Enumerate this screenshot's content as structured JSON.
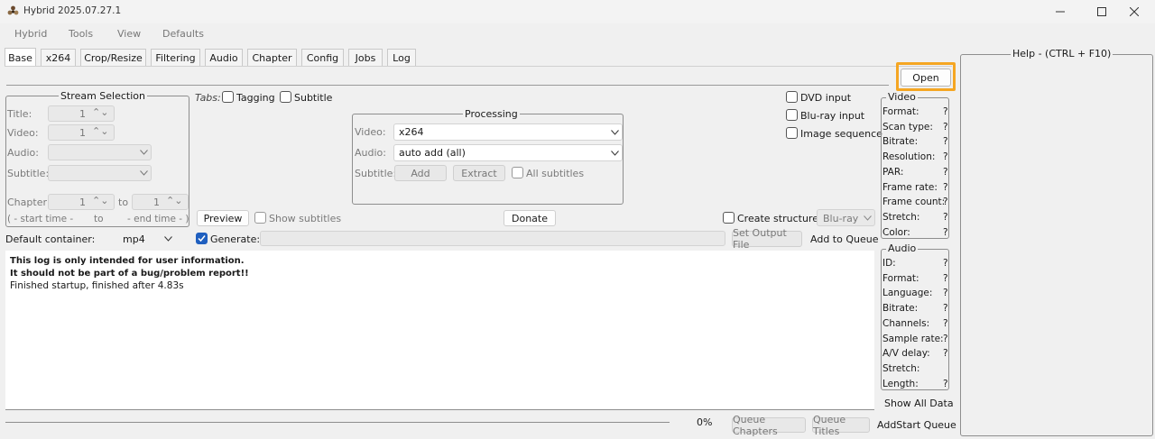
{
  "window": {
    "title": "Hybrid 2025.07.27.1"
  },
  "menu": [
    "Hybrid",
    "Tools",
    "View",
    "Defaults"
  ],
  "tabs": [
    "Base",
    "x264",
    "Crop/Resize",
    "Filtering",
    "Audio",
    "Chapter",
    "Config",
    "Jobs",
    "Log"
  ],
  "open_button": "Open",
  "help_panel": {
    "title": "Help - (CTRL + F10)"
  },
  "stream_selection": {
    "title": "Stream Selection",
    "title_label": "Title:",
    "title_value": "1",
    "video_label": "Video:",
    "video_value": "1",
    "audio_label": "Audio:",
    "subtitle_label": "Subtitle:",
    "chapter_label": "Chapter:",
    "chapter_from": "1",
    "to_label": "to",
    "chapter_to": "1",
    "start_time": "( - start time -",
    "to_label2": "to",
    "end_time": "- end time - )"
  },
  "tabs_options": {
    "label": "Tabs:",
    "tagging": "Tagging",
    "subtitle": "Subtitle"
  },
  "processing": {
    "title": "Processing",
    "video_label": "Video:",
    "video_value": "x264",
    "audio_label": "Audio:",
    "audio_value": "auto add (all)",
    "subtitle_label": "Subtitle:",
    "add": "Add",
    "extract": "Extract",
    "all_subtitles": "All subtitles"
  },
  "inputs": {
    "dvd": "DVD input",
    "bluray": "Blu-ray input",
    "image_seq": "Image sequence"
  },
  "preview": {
    "button": "Preview",
    "show_subtitles": "Show subtitles"
  },
  "donate": "Donate",
  "create_structure": {
    "label": "Create structure:",
    "value": "Blu-ray"
  },
  "output": {
    "default_container_label": "Default container:",
    "container_value": "mp4",
    "generate": "Generate:",
    "set_output": "Set Output File",
    "add_queue": "Add to Queue"
  },
  "log": [
    "This log is only intended for user information.",
    "It should not be part of a bug/problem report!!",
    "Finished startup, finished after 4.83s"
  ],
  "video_info": {
    "title": "Video",
    "rows": [
      {
        "label": "Format:",
        "value": "?"
      },
      {
        "label": "Scan type:",
        "value": "?"
      },
      {
        "label": "Bitrate:",
        "value": "?"
      },
      {
        "label": "Resolution:",
        "value": "?"
      },
      {
        "label": "PAR:",
        "value": "?"
      },
      {
        "label": "Frame rate:",
        "value": "?"
      },
      {
        "label": "Frame count:",
        "value": "?"
      },
      {
        "label": "Stretch:",
        "value": "?"
      },
      {
        "label": "Color:",
        "value": "?"
      }
    ]
  },
  "audio_info": {
    "title": "Audio",
    "rows": [
      {
        "label": "ID:",
        "value": "?"
      },
      {
        "label": "Format:",
        "value": "?"
      },
      {
        "label": "Language:",
        "value": "?"
      },
      {
        "label": "Bitrate:",
        "value": "?"
      },
      {
        "label": "Channels:",
        "value": "?"
      },
      {
        "label": "Sample rate:",
        "value": "?"
      },
      {
        "label": "A/V delay:",
        "value": "?"
      },
      {
        "label": "Stretch:",
        "value": ""
      },
      {
        "label": "Length:",
        "value": "?"
      }
    ]
  },
  "show_all_data": "Show All Data",
  "bottom": {
    "progress": "0%",
    "progress_value": 0,
    "queue_chapters": "Queue Chapters",
    "queue_titles": "Queue Titles",
    "add_start_queue": "AddStart Queue"
  },
  "colors": {
    "accent": "#1f5fbf",
    "highlight": "#f5a623"
  }
}
